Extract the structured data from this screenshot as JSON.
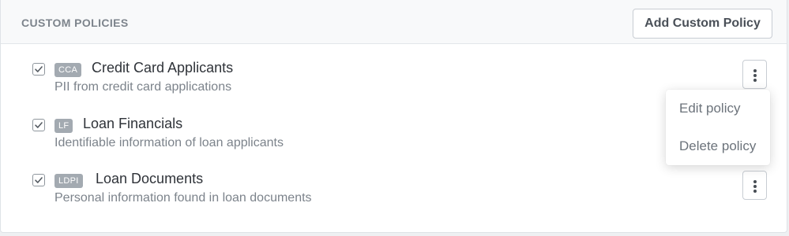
{
  "section": {
    "title": "CUSTOM POLICIES",
    "add_button_label": "Add Custom Policy"
  },
  "policies": [
    {
      "badge": "CCA",
      "name": "Credit Card Applicants",
      "description": "PII from credit card applications",
      "checked": true
    },
    {
      "badge": "LF",
      "name": "Loan Financials",
      "description": "Identifiable information of loan applicants",
      "checked": true
    },
    {
      "badge": "LDPI",
      "name": "Loan Documents",
      "description": "Personal information found in loan documents",
      "checked": true
    }
  ],
  "context_menu": {
    "items": [
      "Edit policy",
      "Delete policy"
    ]
  },
  "icons": {
    "checkbox": "checkmark-icon",
    "row_actions": "vertical-ellipsis-icon"
  },
  "colors": {
    "badge_bg": "#a3aab1",
    "header_bg": "#f8f9fa",
    "muted_text": "#7c838b"
  }
}
